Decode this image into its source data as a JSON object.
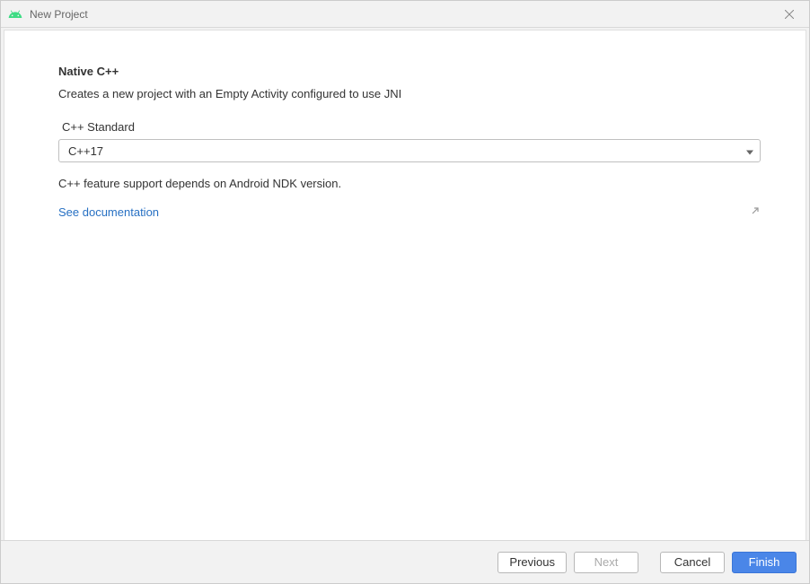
{
  "window": {
    "title": "New Project"
  },
  "page": {
    "heading": "Native C++",
    "description": "Creates a new project with an Empty Activity configured to use JNI"
  },
  "form": {
    "cpp_standard": {
      "label": "C++ Standard",
      "value": "C++17"
    },
    "info": "C++ feature support depends on Android NDK version.",
    "doc_link": "See documentation"
  },
  "footer": {
    "previous": "Previous",
    "next": "Next",
    "cancel": "Cancel",
    "finish": "Finish"
  }
}
